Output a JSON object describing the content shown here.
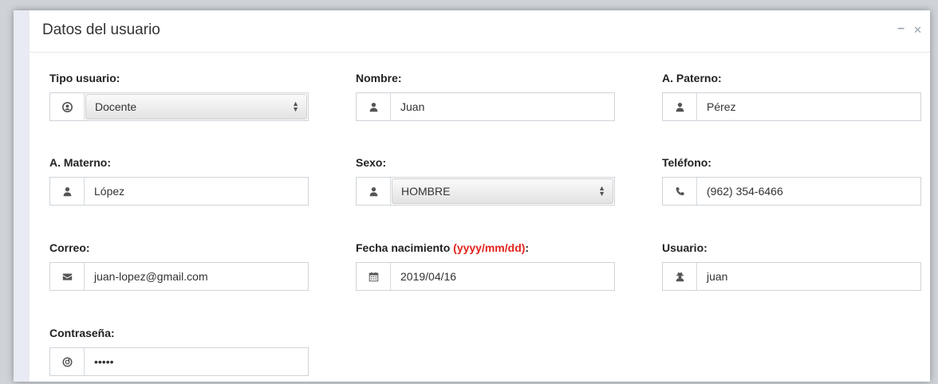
{
  "panel": {
    "title": "Datos del usuario",
    "minimize_icon": "minus-icon",
    "close_icon": "close-icon"
  },
  "fields": {
    "tipo_usuario": {
      "label": "Tipo usuario:",
      "value": "Docente",
      "icon": "user-circle-icon"
    },
    "nombre": {
      "label": "Nombre:",
      "value": "Juan",
      "icon": "user-icon"
    },
    "a_paterno": {
      "label": "A. Paterno:",
      "value": "Pérez",
      "icon": "user-icon"
    },
    "a_materno": {
      "label": "A. Materno:",
      "value": "López",
      "icon": "user-icon"
    },
    "sexo": {
      "label": "Sexo:",
      "value": "HOMBRE",
      "icon": "user-icon"
    },
    "telefono": {
      "label": "Teléfono:",
      "value": "(962) 354-6466",
      "icon": "phone-icon"
    },
    "correo": {
      "label": "Correo:",
      "value": "juan-lopez@gmail.com",
      "icon": "envelope-icon"
    },
    "fecha_nacimiento": {
      "label": "Fecha nacimiento ",
      "hint": "(yyyy/mm/dd)",
      "label_suffix": ":",
      "value": "2019/04/16",
      "icon": "calendar-icon"
    },
    "usuario": {
      "label": "Usuario:",
      "value": "juan",
      "icon": "user-secret-icon"
    },
    "contrasena": {
      "label": "Contraseña:",
      "value": "•••••",
      "icon": "lock-circle-icon"
    }
  },
  "colors": {
    "hint": "#e3221c",
    "border": "#cfd4d9",
    "sidebar": "#e8ebf3"
  }
}
